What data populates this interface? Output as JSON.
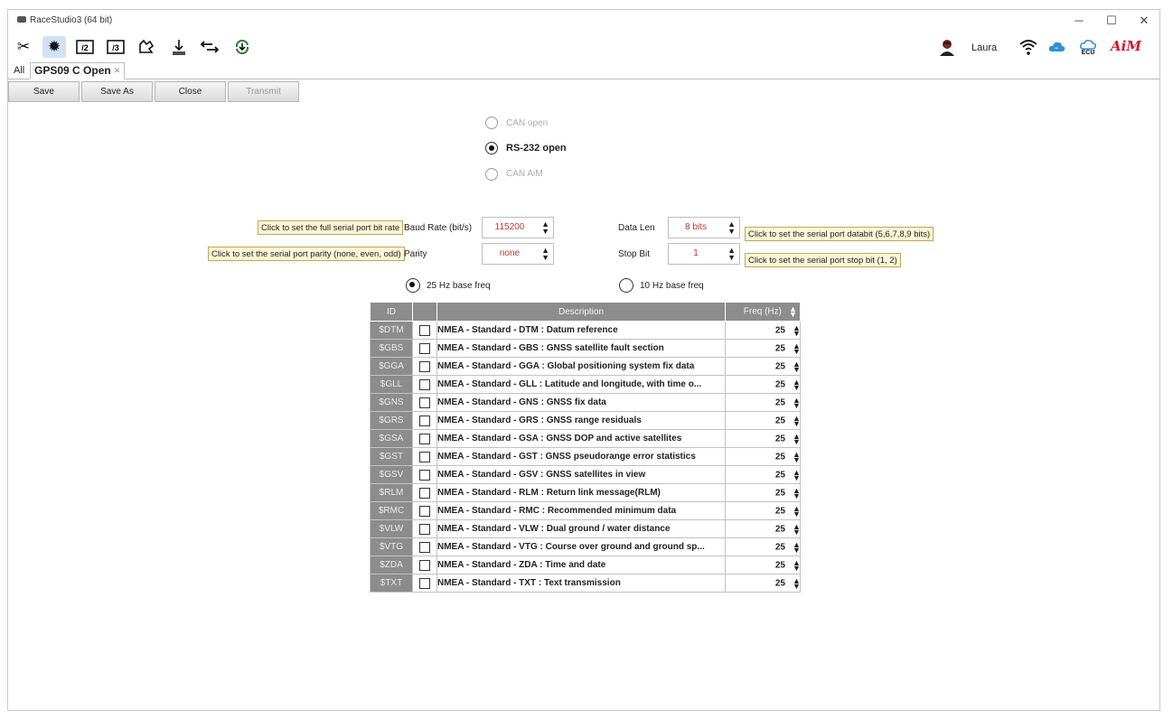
{
  "window": {
    "title": "RaceStudio3 (64 bit)",
    "min": "─",
    "max": "☐",
    "close": "✕"
  },
  "header": {
    "user": "Laura",
    "ecu_label": "ECU",
    "brand": "AiM"
  },
  "tabs": {
    "all": "All",
    "doc": "GPS09 C Open",
    "doc_close": "✕"
  },
  "buttons": {
    "save": "Save",
    "save_as": "Save As",
    "close": "Close",
    "transmit": "Transmit"
  },
  "mode": {
    "options": [
      "CAN open",
      "RS-232 open",
      "CAN AiM"
    ],
    "selected": "RS-232 open"
  },
  "serial": {
    "baud_label": "Baud Rate (bit/s)",
    "baud_value": "115200",
    "baud_tip": "Click to set the full serial port bit rate",
    "parity_label": "Parity",
    "parity_value": "none",
    "parity_tip": "Click to set the serial port parity (none, even, odd)",
    "datalen_label": "Data Len",
    "datalen_value": "8 bits",
    "datalen_tip": "Click to set the serial port databit (5,6,7,8,9 bits)",
    "stopbit_label": "Stop Bit",
    "stopbit_value": "1",
    "stopbit_tip": "Click to set the serial port stop bit (1, 2)"
  },
  "base_freq": {
    "options": [
      "25 Hz base freq",
      "10 Hz base freq"
    ],
    "selected": "25 Hz base freq"
  },
  "table": {
    "headers": {
      "id": "ID",
      "desc": "Description",
      "freq": "Freq (Hz)"
    },
    "rows": [
      {
        "id": "$DTM",
        "desc": "NMEA - Standard - DTM : Datum reference",
        "freq": "25"
      },
      {
        "id": "$GBS",
        "desc": "NMEA - Standard - GBS : GNSS satellite fault section",
        "freq": "25"
      },
      {
        "id": "$GGA",
        "desc": "NMEA - Standard - GGA : Global positioning system fix data",
        "freq": "25"
      },
      {
        "id": "$GLL",
        "desc": "NMEA - Standard - GLL : Latitude and longitude, with time o...",
        "freq": "25"
      },
      {
        "id": "$GNS",
        "desc": "NMEA - Standard - GNS : GNSS fix data",
        "freq": "25"
      },
      {
        "id": "$GRS",
        "desc": "NMEA - Standard - GRS : GNSS range residuals",
        "freq": "25"
      },
      {
        "id": "$GSA",
        "desc": "NMEA - Standard - GSA : GNSS DOP and active satellites",
        "freq": "25"
      },
      {
        "id": "$GST",
        "desc": "NMEA - Standard - GST : GNSS pseudorange error statistics",
        "freq": "25"
      },
      {
        "id": "$GSV",
        "desc": "NMEA - Standard - GSV : GNSS satellites in view",
        "freq": "25"
      },
      {
        "id": "$RLM",
        "desc": "NMEA - Standard - RLM : Return link message(RLM)",
        "freq": "25"
      },
      {
        "id": "$RMC",
        "desc": "NMEA - Standard - RMC : Recommended minimum data",
        "freq": "25"
      },
      {
        "id": "$VLW",
        "desc": "NMEA - Standard - VLW : Dual ground / water distance",
        "freq": "25"
      },
      {
        "id": "$VTG",
        "desc": "NMEA - Standard - VTG : Course over ground and ground sp...",
        "freq": "25"
      },
      {
        "id": "$ZDA",
        "desc": "NMEA - Standard - ZDA : Time and date",
        "freq": "25"
      },
      {
        "id": "$TXT",
        "desc": "NMEA - Standard - TXT : Text transmission",
        "freq": "25"
      }
    ]
  },
  "colors": {
    "accent": "#c0392b",
    "header_gray": "#8c8c8c",
    "tip_bg": "#fbf6d4",
    "brand_red": "#d3172b"
  }
}
